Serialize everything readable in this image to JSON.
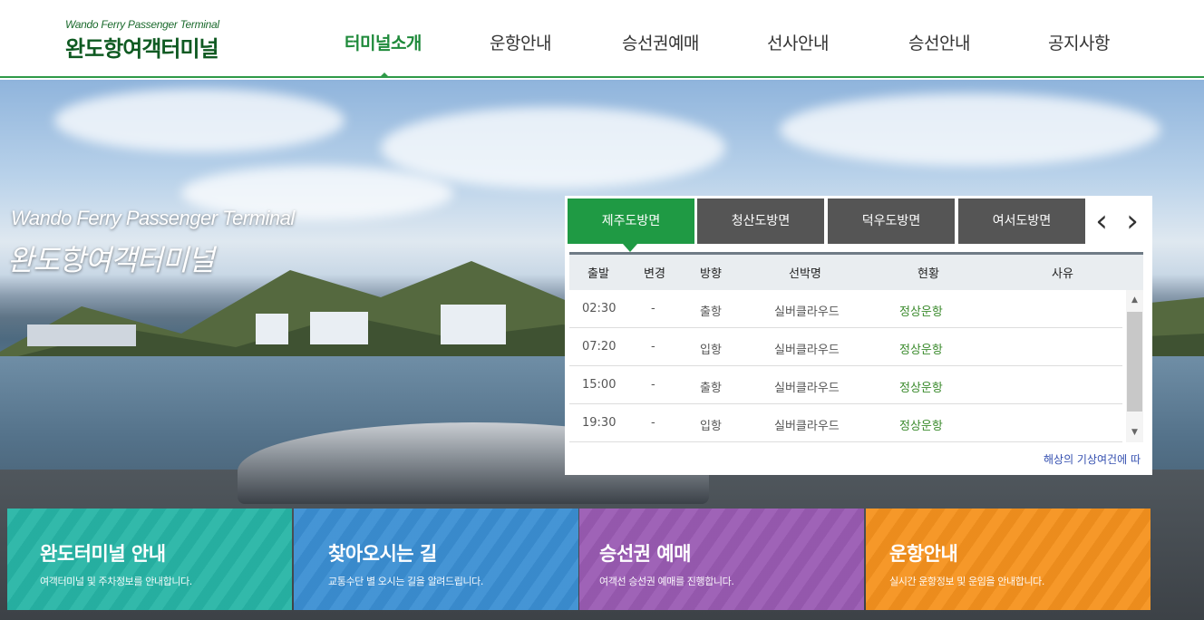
{
  "header": {
    "logo_en": "Wando Ferry Passenger Terminal",
    "logo_ko": "완도항여객터미널",
    "nav": [
      {
        "label": "터미널소개",
        "active": true
      },
      {
        "label": "운항안내",
        "active": false
      },
      {
        "label": "승선권예매",
        "active": false
      },
      {
        "label": "선사안내",
        "active": false
      },
      {
        "label": "승선안내",
        "active": false
      },
      {
        "label": "공지사항",
        "active": false
      }
    ]
  },
  "hero": {
    "title_en": "Wando Ferry Passenger Terminal",
    "title_ko": "완도항여객터미널"
  },
  "schedule": {
    "tabs": [
      "제주도방면",
      "청산도방면",
      "덕우도방면",
      "여서도방면"
    ],
    "active_tab": "제주도방면",
    "prev_icon": "chevron-left-icon",
    "next_icon": "chevron-right-icon",
    "columns": [
      "출발",
      "변경",
      "방향",
      "선박명",
      "현황",
      "사유"
    ],
    "rows": [
      {
        "depart": "02:30",
        "change": "-",
        "direction": "출항",
        "ship": "실버클라우드",
        "status": "정상운항",
        "reason": ""
      },
      {
        "depart": "07:20",
        "change": "-",
        "direction": "입항",
        "ship": "실버클라우드",
        "status": "정상운항",
        "reason": ""
      },
      {
        "depart": "15:00",
        "change": "-",
        "direction": "출항",
        "ship": "실버클라우드",
        "status": "정상운항",
        "reason": ""
      },
      {
        "depart": "19:30",
        "change": "-",
        "direction": "입항",
        "ship": "실버클라우드",
        "status": "정상운항",
        "reason": ""
      }
    ],
    "notice": "해상의 기상여건에 따"
  },
  "cards": [
    {
      "title": "완도터미널 안내",
      "desc": "여객터미널 및 주차정보를 안내합니다.",
      "color": "#27b5a6"
    },
    {
      "title": "찾아오시는 길",
      "desc": "교통수단 별 오시는 길을 알려드립니다.",
      "color": "#3b8fd3"
    },
    {
      "title": "승선권 예매",
      "desc": "여객선 승선권 예매를 진행합니다.",
      "color": "#9a5bb3"
    },
    {
      "title": "운항안내",
      "desc": "실시간 운항정보 및 운임을 안내합니다.",
      "color": "#f5921e"
    }
  ]
}
